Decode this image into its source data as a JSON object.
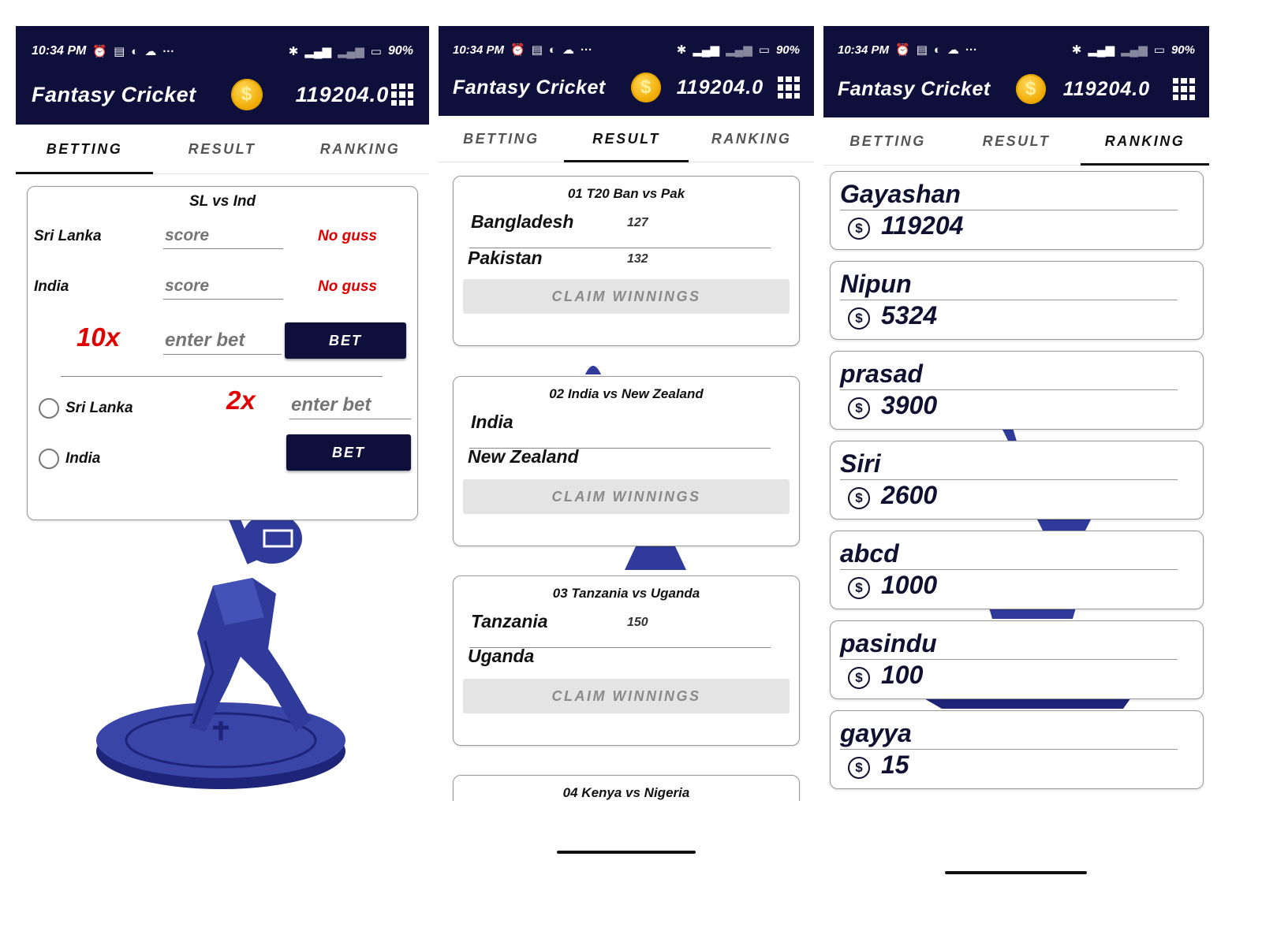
{
  "status_bar": {
    "time": "10:34 PM",
    "battery": "90%",
    "left_icons": [
      "alarm-icon",
      "notes-icon",
      "vpn-icon",
      "cloud-icon",
      "more-dots-icon"
    ],
    "right_icons": [
      "bluetooth-icon",
      "signal-icon",
      "signal-off-icon",
      "battery-icon"
    ]
  },
  "app": {
    "title": "Fantasy Cricket",
    "balance": "119204.0",
    "coin_symbol": "$"
  },
  "tabs": [
    "BETTING",
    "RESULT",
    "RANKING"
  ],
  "colors": {
    "primary": "#0e0f3a",
    "accent_red": "#e00000",
    "coin": "#f0a800",
    "player": "#2f3a9a"
  },
  "betting": {
    "match_title": "SL vs Ind",
    "team1": "Sri Lanka",
    "team2": "India",
    "score_placeholder": "score",
    "no_guess": "No guss",
    "multiplier_score": "10x",
    "bet_placeholder": "enter bet",
    "bet_button": "BET",
    "multiplier_winner": "2x",
    "radio_team1": "Sri Lanka",
    "radio_team2": "India"
  },
  "results": {
    "claim_label": "CLAIM WINNINGS",
    "matches": [
      {
        "title": "01 T20 Ban vs Pak",
        "team1": "Bangladesh",
        "score1": "127",
        "team2": "Pakistan",
        "score2": "132"
      },
      {
        "title": "02 India vs New Zealand",
        "team1": "India",
        "score1": "",
        "team2": "New Zealand",
        "score2": ""
      },
      {
        "title": "03 Tanzania vs Uganda",
        "team1": "Tanzania",
        "score1": "150",
        "team2": "Uganda",
        "score2": ""
      },
      {
        "title": "04 Kenya vs Nigeria"
      }
    ]
  },
  "ranking": {
    "currency_symbol": "$",
    "players": [
      {
        "name": "Gayashan",
        "score": "119204"
      },
      {
        "name": "Nipun",
        "score": "5324"
      },
      {
        "name": "prasad",
        "score": "3900"
      },
      {
        "name": "Siri",
        "score": "2600"
      },
      {
        "name": "abcd",
        "score": "1000"
      },
      {
        "name": "pasindu",
        "score": "100"
      },
      {
        "name": "gayya",
        "score": "15"
      }
    ]
  }
}
